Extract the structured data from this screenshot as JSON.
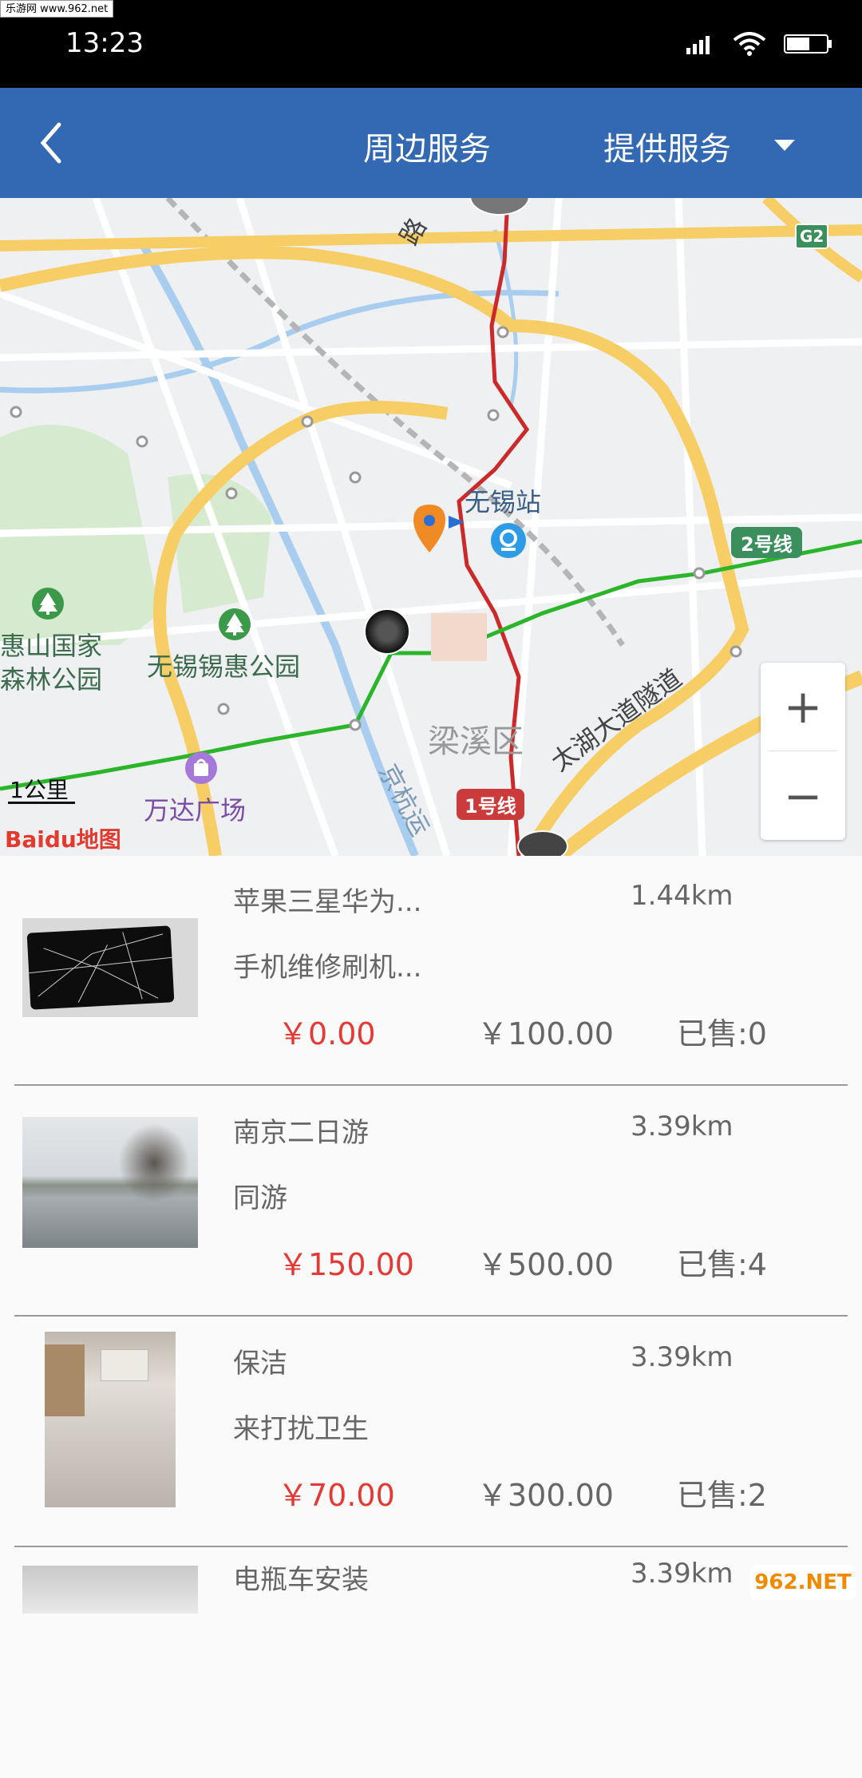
{
  "watermark_top": "乐游网 www.962.net",
  "status": {
    "time": "13:23"
  },
  "appbar": {
    "title": "周边服务",
    "provide_label": "提供服务"
  },
  "map": {
    "labels": {
      "station": "无锡站",
      "park1_line1": "惠山国家",
      "park1_line2": "森林公园",
      "park2": "无锡锡惠公园",
      "mall": "万达广场",
      "district": "梁溪区",
      "tunnel": "太湖大道隧道",
      "line1": "1号线",
      "line2": "2号线",
      "highway": "G2",
      "road_top": "路",
      "canal": "京杭运"
    },
    "scale": "1公里",
    "brand": "Baidu地图",
    "zoom_in": "+",
    "zoom_out": "−"
  },
  "items": [
    {
      "name": "苹果三星华为...",
      "desc": "手机维修刷机...",
      "distance": "1.44km",
      "price": "￥0.00",
      "original_price": "￥100.00",
      "sold": "已售:0"
    },
    {
      "name": "南京二日游",
      "desc": "同游",
      "distance": "3.39km",
      "price": "￥150.00",
      "original_price": "￥500.00",
      "sold": "已售:4"
    },
    {
      "name": "保洁",
      "desc": "来打扰卫生",
      "distance": "3.39km",
      "price": "￥70.00",
      "original_price": "￥300.00",
      "sold": "已售:2"
    },
    {
      "name": "电瓶车安装",
      "desc": "",
      "distance": "3.39km",
      "price": "",
      "original_price": "",
      "sold": ""
    }
  ],
  "watermark_bottom": "962.NET"
}
